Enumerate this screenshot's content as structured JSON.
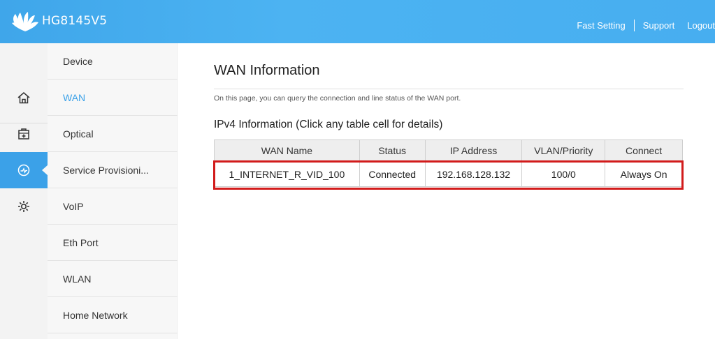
{
  "header": {
    "brand": "HG8145V5",
    "logo_icon": "huawei-logo",
    "links": {
      "fast_setting": "Fast Setting",
      "support": "Support",
      "logout": "Logout"
    }
  },
  "rail": {
    "items": [
      {
        "icon": "home-icon"
      },
      {
        "icon": "toolbox-icon"
      },
      {
        "icon": "gauge-icon",
        "active": true
      },
      {
        "icon": "gear-icon"
      }
    ]
  },
  "menu": {
    "items": [
      {
        "label": "Device"
      },
      {
        "label": "WAN",
        "active": true
      },
      {
        "label": "Optical"
      },
      {
        "label": "Service Provisioni..."
      },
      {
        "label": "VoIP"
      },
      {
        "label": "Eth Port"
      },
      {
        "label": "WLAN"
      },
      {
        "label": "Home Network"
      }
    ]
  },
  "main": {
    "title": "WAN Information",
    "description": "On this page, you can query the connection and line status of the WAN port.",
    "subtitle": "IPv4 Information (Click any table cell for details)",
    "table": {
      "headers": [
        "WAN Name",
        "Status",
        "IP Address",
        "VLAN/Priority",
        "Connect"
      ],
      "rows": [
        [
          "1_INTERNET_R_VID_100",
          "Connected",
          "192.168.128.132",
          "100/0",
          "Always On"
        ]
      ]
    }
  },
  "colors": {
    "header_blue": "#47aef0",
    "active_blue": "#3ba1e8",
    "highlight_red": "#d21b1b"
  }
}
